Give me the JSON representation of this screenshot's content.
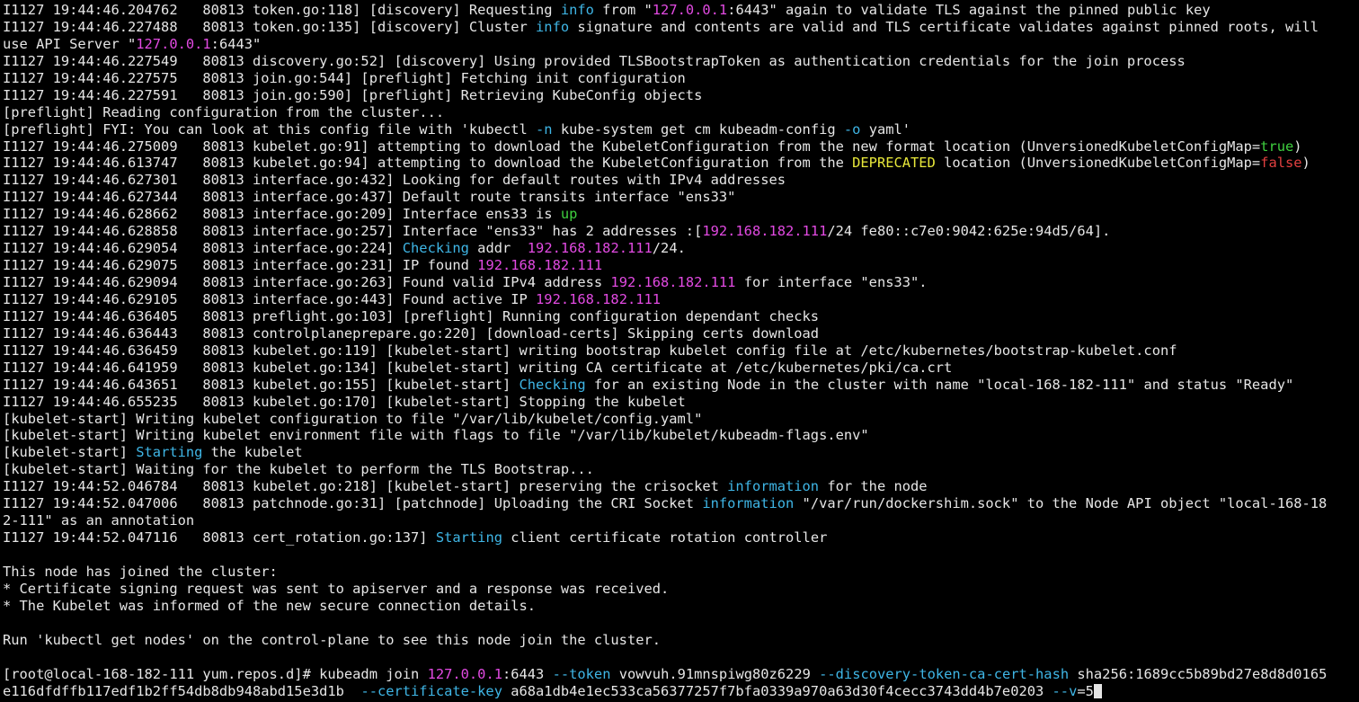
{
  "colors": {
    "background": "#000000",
    "text": "#e6e6e6",
    "cyan": "#3fb6e6",
    "magenta": "#e24ae2",
    "green": "#3fd03f",
    "yellow": "#e8e83a",
    "red": "#e24040"
  },
  "terminal": {
    "lines": [
      [
        {
          "t": "I1127 19:44:46.204762   80813 token.go:118] [discovery] Requesting "
        },
        {
          "t": "info",
          "c": "cyan"
        },
        {
          "t": " from \""
        },
        {
          "t": "127.0.0.1",
          "c": "magenta"
        },
        {
          "t": ":6443\" again to validate TLS against the pinned public key"
        }
      ],
      [
        {
          "t": "I1127 19:44:46.227488   80813 token.go:135] [discovery] Cluster "
        },
        {
          "t": "info",
          "c": "cyan"
        },
        {
          "t": " signature and contents are valid and TLS certificate validates against pinned roots, will"
        }
      ],
      [
        {
          "t": "use API Server \""
        },
        {
          "t": "127.0.0.1",
          "c": "magenta"
        },
        {
          "t": ":6443\""
        }
      ],
      [
        {
          "t": "I1127 19:44:46.227549   80813 discovery.go:52] [discovery] Using provided TLSBootstrapToken as authentication credentials for the join process"
        }
      ],
      [
        {
          "t": "I1127 19:44:46.227575   80813 join.go:544] [preflight] Fetching init configuration"
        }
      ],
      [
        {
          "t": "I1127 19:44:46.227591   80813 join.go:590] [preflight] Retrieving KubeConfig objects"
        }
      ],
      [
        {
          "t": "[preflight] Reading configuration from the cluster..."
        }
      ],
      [
        {
          "t": "[preflight] FYI: You can look at this config file with 'kubectl "
        },
        {
          "t": "-n",
          "c": "cyan"
        },
        {
          "t": " kube-system get cm kubeadm-config "
        },
        {
          "t": "-o",
          "c": "cyan"
        },
        {
          "t": " yaml'"
        }
      ],
      [
        {
          "t": "I1127 19:44:46.275009   80813 kubelet.go:91] attempting to download the KubeletConfiguration from the new format location (UnversionedKubeletConfigMap="
        },
        {
          "t": "true",
          "c": "green"
        },
        {
          "t": ")"
        }
      ],
      [
        {
          "t": "I1127 19:44:46.613747   80813 kubelet.go:94] attempting to download the KubeletConfiguration from the "
        },
        {
          "t": "DEPRECATED",
          "c": "yellow"
        },
        {
          "t": " location (UnversionedKubeletConfigMap="
        },
        {
          "t": "false",
          "c": "red"
        },
        {
          "t": ")"
        }
      ],
      [
        {
          "t": "I1127 19:44:46.627301   80813 interface.go:432] Looking for default routes with IPv4 addresses"
        }
      ],
      [
        {
          "t": "I1127 19:44:46.627344   80813 interface.go:437] Default route transits interface \"ens33\""
        }
      ],
      [
        {
          "t": "I1127 19:44:46.628662   80813 interface.go:209] Interface ens33 is "
        },
        {
          "t": "up",
          "c": "green"
        }
      ],
      [
        {
          "t": "I1127 19:44:46.628858   80813 interface.go:257] Interface \"ens33\" has 2 addresses :["
        },
        {
          "t": "192.168.182.111",
          "c": "magenta"
        },
        {
          "t": "/24 fe80::c7e0:9042:625e:94d5/64]."
        }
      ],
      [
        {
          "t": "I1127 19:44:46.629054   80813 interface.go:224] "
        },
        {
          "t": "Checking",
          "c": "cyan"
        },
        {
          "t": " addr  "
        },
        {
          "t": "192.168.182.111",
          "c": "magenta"
        },
        {
          "t": "/24."
        }
      ],
      [
        {
          "t": "I1127 19:44:46.629075   80813 interface.go:231] IP found "
        },
        {
          "t": "192.168.182.111",
          "c": "magenta"
        }
      ],
      [
        {
          "t": "I1127 19:44:46.629094   80813 interface.go:263] Found valid IPv4 address "
        },
        {
          "t": "192.168.182.111",
          "c": "magenta"
        },
        {
          "t": " for interface \"ens33\"."
        }
      ],
      [
        {
          "t": "I1127 19:44:46.629105   80813 interface.go:443] Found active IP "
        },
        {
          "t": "192.168.182.111",
          "c": "magenta"
        }
      ],
      [
        {
          "t": "I1127 19:44:46.636405   80813 preflight.go:103] [preflight] Running configuration dependant checks"
        }
      ],
      [
        {
          "t": "I1127 19:44:46.636443   80813 controlplaneprepare.go:220] [download-certs] Skipping certs download"
        }
      ],
      [
        {
          "t": "I1127 19:44:46.636459   80813 kubelet.go:119] [kubelet-start] writing bootstrap kubelet config file at /etc/kubernetes/bootstrap-kubelet.conf"
        }
      ],
      [
        {
          "t": "I1127 19:44:46.641959   80813 kubelet.go:134] [kubelet-start] writing CA certificate at /etc/kubernetes/pki/ca.crt"
        }
      ],
      [
        {
          "t": "I1127 19:44:46.643651   80813 kubelet.go:155] [kubelet-start] "
        },
        {
          "t": "Checking",
          "c": "cyan"
        },
        {
          "t": " for an existing Node in the cluster with name \"local-168-182-111\" and status \"Ready\""
        }
      ],
      [
        {
          "t": "I1127 19:44:46.655235   80813 kubelet.go:170] [kubelet-start] Stopping the kubelet"
        }
      ],
      [
        {
          "t": "[kubelet-start] Writing kubelet configuration to file \"/var/lib/kubelet/config.yaml\""
        }
      ],
      [
        {
          "t": "[kubelet-start] Writing kubelet environment file with flags to file \"/var/lib/kubelet/kubeadm-flags.env\""
        }
      ],
      [
        {
          "t": "[kubelet-start] "
        },
        {
          "t": "Starting",
          "c": "cyan"
        },
        {
          "t": " the kubelet"
        }
      ],
      [
        {
          "t": "[kubelet-start] Waiting for the kubelet to perform the TLS Bootstrap..."
        }
      ],
      [
        {
          "t": "I1127 19:44:52.046784   80813 kubelet.go:218] [kubelet-start] preserving the crisocket "
        },
        {
          "t": "information",
          "c": "cyan"
        },
        {
          "t": " for the node"
        }
      ],
      [
        {
          "t": "I1127 19:44:52.047006   80813 patchnode.go:31] [patchnode] Uploading the CRI Socket "
        },
        {
          "t": "information",
          "c": "cyan"
        },
        {
          "t": " \"/var/run/dockershim.sock\" to the Node API object \"local-168-18"
        }
      ],
      [
        {
          "t": "2-111\" as an annotation"
        }
      ],
      [
        {
          "t": "I1127 19:44:52.047116   80813 cert_rotation.go:137] "
        },
        {
          "t": "Starting",
          "c": "cyan"
        },
        {
          "t": " client certificate rotation controller"
        }
      ],
      [
        {
          "t": ""
        }
      ],
      [
        {
          "t": "This node has joined the cluster:"
        }
      ],
      [
        {
          "t": "* Certificate signing request was sent to apiserver and a response was received."
        }
      ],
      [
        {
          "t": "* The Kubelet was informed of the new secure connection details."
        }
      ],
      [
        {
          "t": ""
        }
      ],
      [
        {
          "t": "Run 'kubectl get nodes' on the control-plane to see this node join the cluster."
        }
      ],
      [
        {
          "t": ""
        }
      ],
      [
        {
          "t": "[root@local-168-182-111 yum.repos.d]# kubeadm join "
        },
        {
          "t": "127.0.0.1",
          "c": "magenta"
        },
        {
          "t": ":6443 "
        },
        {
          "t": "--token",
          "c": "cyan"
        },
        {
          "t": " vowvuh.91mnspiwg80z6229 "
        },
        {
          "t": "--discovery-token-ca-cert-hash",
          "c": "cyan"
        },
        {
          "t": " sha256:1689cc5b89bd27e8d8d0165"
        }
      ],
      [
        {
          "t": "e116dfdffb117edf1b2ff54db8db948abd15e3d1b  "
        },
        {
          "t": "--certificate-key",
          "c": "cyan"
        },
        {
          "t": " a68a1db4e1ec533ca56377257f7bfa0339a970a63d30f4cecc3743dd4b7e0203 "
        },
        {
          "t": "--v",
          "c": "cyan"
        },
        {
          "t": "=5"
        }
      ]
    ]
  }
}
